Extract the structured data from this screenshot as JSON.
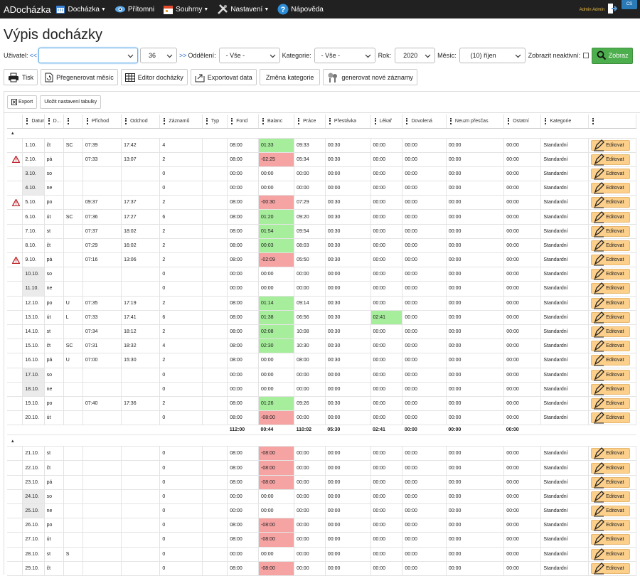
{
  "app": {
    "title": "ADocházka",
    "admin": "Admin Admin",
    "lang": "CS"
  },
  "nav": [
    {
      "label": "Docházka",
      "icon": "calendar-icon",
      "caret": true
    },
    {
      "label": "Přítomni",
      "icon": "eye-icon",
      "caret": false
    },
    {
      "label": "Souhrny",
      "icon": "summary-calendar-icon",
      "caret": true
    },
    {
      "label": "Nastavení",
      "icon": "tools-icon",
      "caret": true
    },
    {
      "label": "Nápověda",
      "icon": "help-icon",
      "caret": false
    }
  ],
  "page_title": "Výpis docházky",
  "filters": {
    "user_label": "Uživatel:",
    "prev": "<<",
    "user_value": "",
    "user_num": "36",
    "next": ">>",
    "dept_label": "Oddělení:",
    "dept_value": "- Vše -",
    "cat_label": "Kategorie:",
    "cat_value": "- Vše -",
    "year_label": "Rok:",
    "year_value": "2020",
    "month_label": "Měsíc:",
    "month_value": "(10) říjen",
    "inactive_label": "Zobrazit neaktivní:",
    "show_button": "Zobraz"
  },
  "toolbar": [
    "Tisk",
    "Přegenerovat měsíc",
    "Editor docházky",
    "Exportovat data",
    "Změna kategorie",
    "generovat nové záznamy"
  ],
  "subtoolbar": {
    "export": "Export",
    "save": "Uložit nastavení tabulky"
  },
  "columns": [
    "Datum",
    "D...",
    "",
    "Příchod",
    "Odchod",
    "Záznamů",
    "Typ",
    "Fond",
    "Balanc",
    "Práce",
    "Přestávka",
    "Lékař",
    "Dovolená",
    "Neuzn přesčas",
    "Ostatní",
    "Kategorie",
    ""
  ],
  "edit_label": "Editovat",
  "group1_rows": [
    [
      "1.10.",
      "čt",
      "SC",
      "07:39",
      "17:42",
      "4",
      "",
      "08:00",
      "01:33",
      "09:33",
      "00:30",
      "00:00",
      "00:00",
      "00:00",
      "00:00",
      "Standardní"
    ],
    [
      "2.10.",
      "pá",
      "",
      "07:33",
      "13:07",
      "2",
      "",
      "08:00",
      "-02:25",
      "05:34",
      "00:30",
      "00:00",
      "00:00",
      "00:00",
      "00:00",
      "Standardní"
    ],
    [
      "3.10.",
      "so",
      "",
      "",
      "",
      "0",
      "",
      "00:00",
      "00:00",
      "00:00",
      "00:00",
      "00:00",
      "00:00",
      "00:00",
      "00:00",
      "Standardní"
    ],
    [
      "4.10.",
      "ne",
      "",
      "",
      "",
      "0",
      "",
      "00:00",
      "00:00",
      "00:00",
      "00:00",
      "00:00",
      "00:00",
      "00:00",
      "00:00",
      "Standardní"
    ],
    [
      "5.10.",
      "po",
      "",
      "09:37",
      "17:37",
      "2",
      "",
      "08:00",
      "-00:30",
      "07:29",
      "00:30",
      "00:00",
      "00:00",
      "00:00",
      "00:00",
      "Standardní"
    ],
    [
      "6.10.",
      "út",
      "SC",
      "07:36",
      "17:27",
      "6",
      "",
      "08:00",
      "01:20",
      "09:20",
      "00:30",
      "00:00",
      "00:00",
      "00:00",
      "00:00",
      "Standardní"
    ],
    [
      "7.10.",
      "st",
      "",
      "07:37",
      "18:02",
      "2",
      "",
      "08:00",
      "01:54",
      "09:54",
      "00:30",
      "00:00",
      "00:00",
      "00:00",
      "00:00",
      "Standardní"
    ],
    [
      "8.10.",
      "čt",
      "",
      "07:29",
      "16:02",
      "2",
      "",
      "08:00",
      "00:03",
      "08:03",
      "00:30",
      "00:00",
      "00:00",
      "00:00",
      "00:00",
      "Standardní"
    ],
    [
      "9.10.",
      "pá",
      "",
      "07:16",
      "13:06",
      "2",
      "",
      "08:00",
      "-02:09",
      "05:50",
      "00:30",
      "00:00",
      "00:00",
      "00:00",
      "00:00",
      "Standardní"
    ],
    [
      "10.10.",
      "so",
      "",
      "",
      "",
      "0",
      "",
      "00:00",
      "00:00",
      "00:00",
      "00:00",
      "00:00",
      "00:00",
      "00:00",
      "00:00",
      "Standardní"
    ],
    [
      "11.10.",
      "ne",
      "",
      "",
      "",
      "0",
      "",
      "00:00",
      "00:00",
      "00:00",
      "00:00",
      "00:00",
      "00:00",
      "00:00",
      "00:00",
      "Standardní"
    ],
    [
      "12.10.",
      "po",
      "U",
      "07:35",
      "17:19",
      "2",
      "",
      "08:00",
      "01:14",
      "09:14",
      "00:30",
      "00:00",
      "00:00",
      "00:00",
      "00:00",
      "Standardní"
    ],
    [
      "13.10.",
      "út",
      "L",
      "07:33",
      "17:41",
      "6",
      "",
      "08:00",
      "01:38",
      "06:56",
      "00:30",
      "02:41",
      "00:00",
      "00:00",
      "00:00",
      "Standardní"
    ],
    [
      "14.10.",
      "st",
      "",
      "07:34",
      "18:12",
      "2",
      "",
      "08:00",
      "02:08",
      "10:08",
      "00:30",
      "00:00",
      "00:00",
      "00:00",
      "00:00",
      "Standardní"
    ],
    [
      "15.10.",
      "čt",
      "SC",
      "07:31",
      "18:32",
      "4",
      "",
      "08:00",
      "02:30",
      "10:30",
      "00:30",
      "00:00",
      "00:00",
      "00:00",
      "00:00",
      "Standardní"
    ],
    [
      "16.10.",
      "pá",
      "U",
      "07:00",
      "15:30",
      "2",
      "",
      "08:00",
      "00:00",
      "08:00",
      "00:30",
      "00:00",
      "00:00",
      "00:00",
      "00:00",
      "Standardní"
    ],
    [
      "17.10.",
      "so",
      "",
      "",
      "",
      "0",
      "",
      "00:00",
      "00:00",
      "00:00",
      "00:00",
      "00:00",
      "00:00",
      "00:00",
      "00:00",
      "Standardní"
    ],
    [
      "18.10.",
      "ne",
      "",
      "",
      "",
      "0",
      "",
      "00:00",
      "00:00",
      "00:00",
      "00:00",
      "00:00",
      "00:00",
      "00:00",
      "00:00",
      "Standardní"
    ],
    [
      "19.10.",
      "po",
      "",
      "07:40",
      "17:36",
      "2",
      "",
      "08:00",
      "01:26",
      "09:26",
      "00:30",
      "00:00",
      "00:00",
      "00:00",
      "00:00",
      "Standardní"
    ],
    [
      "20.10.",
      "út",
      "",
      "",
      "",
      "0",
      "",
      "08:00",
      "-08:00",
      "00:00",
      "00:00",
      "00:00",
      "00:00",
      "00:00",
      "00:00",
      "Standardní"
    ]
  ],
  "group1_sum": [
    "",
    "",
    "",
    "",
    "",
    "",
    "",
    "112:00",
    "00:44",
    "110:02",
    "05:30",
    "02:41",
    "00:00",
    "00:00",
    "00:00",
    "",
    ""
  ],
  "group2_rows": [
    [
      "21.10.",
      "st",
      "",
      "",
      "",
      "0",
      "",
      "08:00",
      "-08:00",
      "00:00",
      "00:00",
      "00:00",
      "00:00",
      "00:00",
      "00:00",
      "Standardní"
    ],
    [
      "22.10.",
      "čt",
      "",
      "",
      "",
      "0",
      "",
      "08:00",
      "-08:00",
      "00:00",
      "00:00",
      "00:00",
      "00:00",
      "00:00",
      "00:00",
      "Standardní"
    ],
    [
      "23.10.",
      "pá",
      "",
      "",
      "",
      "0",
      "",
      "08:00",
      "-08:00",
      "00:00",
      "00:00",
      "00:00",
      "00:00",
      "00:00",
      "00:00",
      "Standardní"
    ],
    [
      "24.10.",
      "so",
      "",
      "",
      "",
      "0",
      "",
      "00:00",
      "00:00",
      "00:00",
      "00:00",
      "00:00",
      "00:00",
      "00:00",
      "00:00",
      "Standardní"
    ],
    [
      "25.10.",
      "ne",
      "",
      "",
      "",
      "0",
      "",
      "00:00",
      "00:00",
      "00:00",
      "00:00",
      "00:00",
      "00:00",
      "00:00",
      "00:00",
      "Standardní"
    ],
    [
      "26.10.",
      "po",
      "",
      "",
      "",
      "0",
      "",
      "08:00",
      "-08:00",
      "00:00",
      "00:00",
      "00:00",
      "00:00",
      "00:00",
      "00:00",
      "Standardní"
    ],
    [
      "27.10.",
      "út",
      "",
      "",
      "",
      "0",
      "",
      "08:00",
      "-08:00",
      "00:00",
      "00:00",
      "00:00",
      "00:00",
      "00:00",
      "00:00",
      "Standardní"
    ],
    [
      "28.10.",
      "st",
      "S",
      "",
      "",
      "0",
      "",
      "00:00",
      "00:00",
      "00:00",
      "00:00",
      "00:00",
      "00:00",
      "00:00",
      "00:00",
      "Standardní"
    ],
    [
      "29.10.",
      "čt",
      "",
      "",
      "",
      "0",
      "",
      "08:00",
      "-08:00",
      "00:00",
      "00:00",
      "00:00",
      "00:00",
      "00:00",
      "00:00",
      "Standardní"
    ]
  ],
  "warning_rows": [
    "2.10.",
    "5.10.",
    "9.10."
  ],
  "colors": {
    "positive": "#a6ed9c",
    "negative": "#f5a3a3",
    "weekend": "#ebebeb",
    "edit": "#fccf8b",
    "show": "#4cae4c"
  }
}
